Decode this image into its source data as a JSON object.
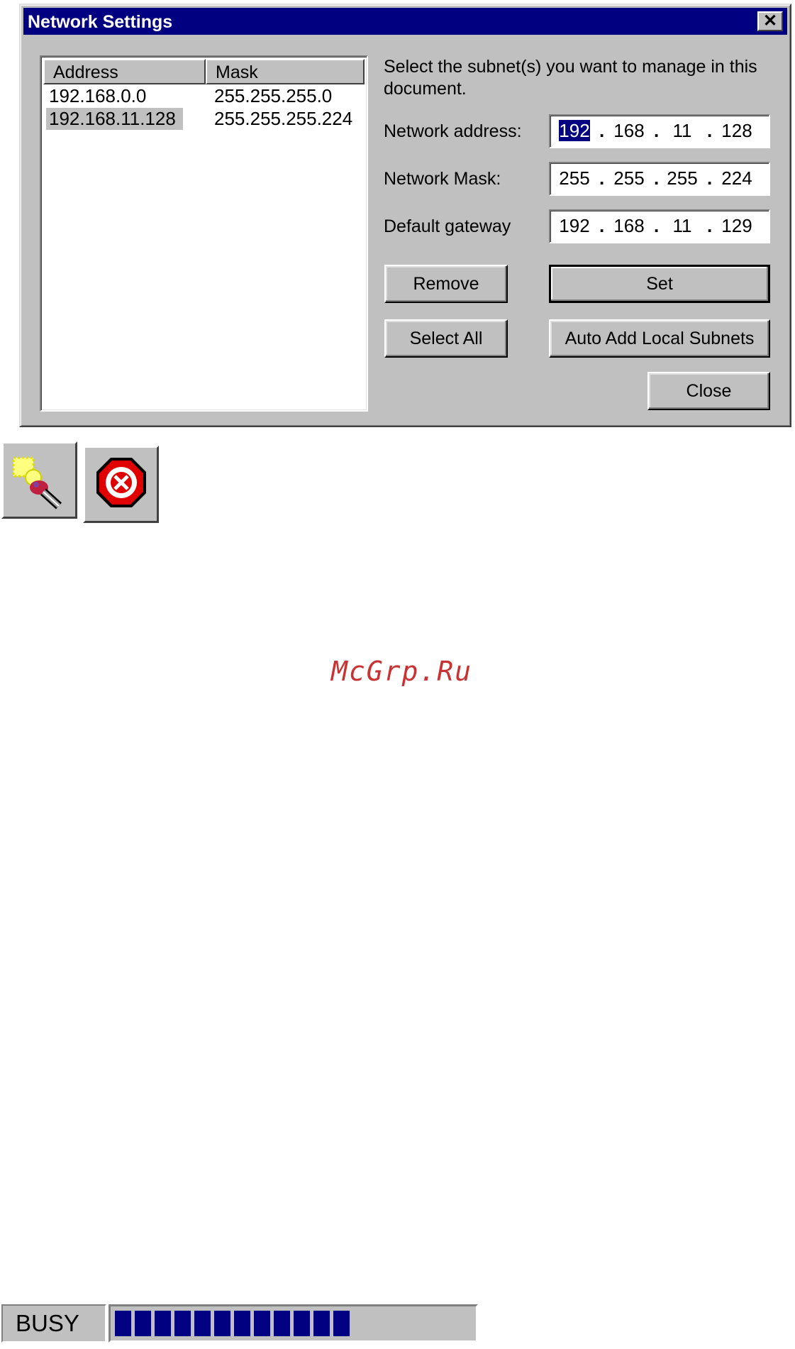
{
  "dialog": {
    "title": "Network Settings",
    "close_glyph": "✕",
    "instructions": "Select the subnet(s) you want to manage in this document.",
    "list": {
      "columns": [
        "Address",
        "Mask"
      ],
      "rows": [
        {
          "address": "192.168.0.0",
          "mask": "255.255.255.0",
          "selected": false
        },
        {
          "address": "192.168.11.128",
          "mask": "255.255.255.224",
          "selected": true
        }
      ]
    },
    "fields": {
      "network_address": {
        "label": "Network address:",
        "octets": [
          "192",
          "168",
          "11",
          "128"
        ]
      },
      "network_mask": {
        "label": "Network Mask:",
        "octets": [
          "255",
          "255",
          "255",
          "224"
        ]
      },
      "default_gateway": {
        "label": "Default gateway",
        "octets": [
          "192",
          "168",
          "11",
          "129"
        ]
      }
    },
    "buttons": {
      "remove": "Remove",
      "set": "Set",
      "select_all": "Select All",
      "auto_add": "Auto Add Local Subnets",
      "close": "Close"
    }
  },
  "toolbar_icons": [
    "locate-subnet-icon",
    "stop-icon"
  ],
  "watermark": "McGrp.Ru",
  "status": {
    "label": "BUSY",
    "progress_segments": 12
  },
  "colors": {
    "title_bar": "#000080",
    "face": "#c0c0c0",
    "highlight": "#000080",
    "progress": "#000080"
  }
}
